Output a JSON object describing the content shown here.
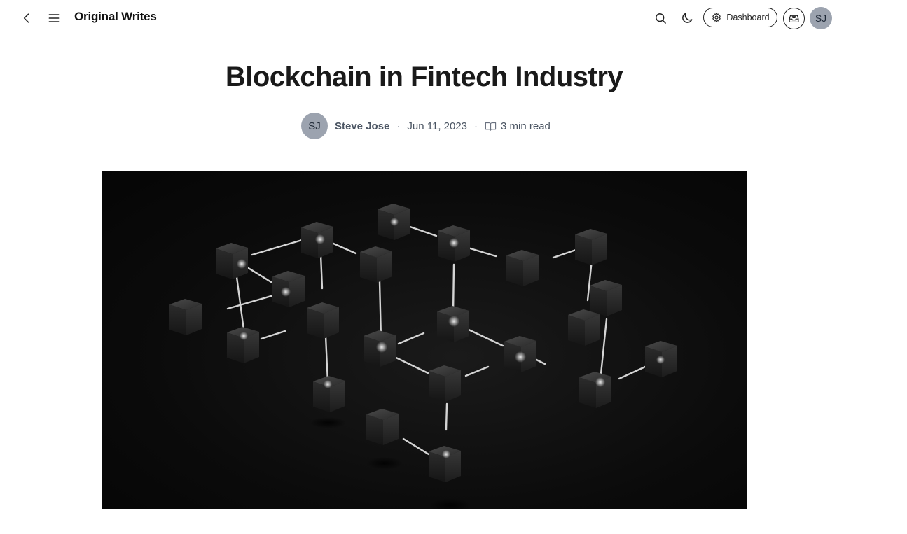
{
  "header": {
    "brand": "Original Writes",
    "dashboard_label": "Dashboard",
    "avatar_initials": "SJ",
    "icons": {
      "back": "chevron-left-icon",
      "menu": "hamburger-menu-icon",
      "search": "search-icon",
      "theme": "moon-icon",
      "dashboard": "gear-icon",
      "inbox": "inbox-icon"
    }
  },
  "article": {
    "title": "Blockchain in Fintech Industry",
    "author": {
      "initials": "SJ",
      "name": "Steve Jose"
    },
    "date": "Jun 11, 2023",
    "separator": "·",
    "read_time": "3 min read",
    "read_icon": "open-book-icon"
  },
  "cover_image": {
    "subject": "network of dark cubes connected by glowing lines",
    "background_color": "#0b0b0b"
  }
}
